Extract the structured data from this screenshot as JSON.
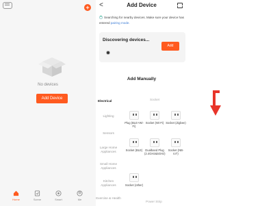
{
  "home": {
    "empty_label": "No devices",
    "add_button": "Add Device",
    "plus_icon": "+",
    "tabs": [
      {
        "label": "Home",
        "icon": "home-icon"
      },
      {
        "label": "Scene",
        "icon": "scene-icon"
      },
      {
        "label": "Smart",
        "icon": "smart-icon"
      },
      {
        "label": "Me",
        "icon": "me-icon"
      }
    ]
  },
  "add_device": {
    "back": "<",
    "title": "Add Device",
    "search_text": "Searching for nearby devices. Make sure your device has entered",
    "pairing_link": "pairing mode.",
    "discovering_title": "Discovering devices...",
    "card_add_button": "Add",
    "add_manually": "Add Manually",
    "categories": [
      "Electrical",
      "Lighting",
      "Sensors",
      "Large Home Appliances",
      "Small Home Appliances",
      "Kitchen Appliances",
      "Exercise & Health"
    ],
    "sub_header": "Socket",
    "products": [
      "Plug (BLE+Wi-Fi)",
      "Socket (Wi-Fi)",
      "Socket (Zigbee)",
      "Socket (BLE)",
      "Dualband Plug (2.4GHz&5GHz)",
      "Socket (NB-IoT)",
      "Socket (other)"
    ],
    "power_strip": "Power Strip"
  },
  "colors": {
    "accent": "#ff5a1f",
    "link": "#3a7bd5",
    "arrow": "#e8352a"
  }
}
